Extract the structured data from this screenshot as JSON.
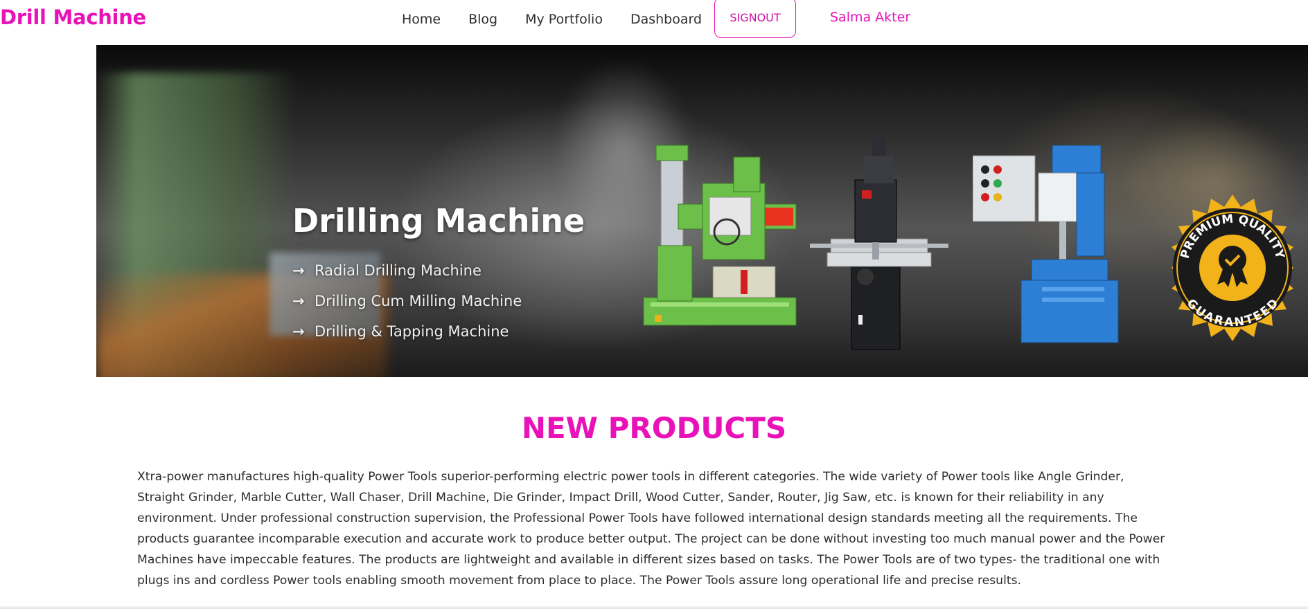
{
  "navbar": {
    "brand": "Drill Machine",
    "links": [
      "Home",
      "Blog",
      "My Portfolio",
      "Dashboard"
    ],
    "signout_label": "SIGNOUT",
    "user_name": "Salma Akter"
  },
  "banner": {
    "title": "Drilling Machine",
    "items": [
      "Radial Drilling Machine",
      "Drilling Cum Milling Machine",
      "Drilling & Tapping Machine"
    ],
    "arrow": "→",
    "badge_top": "PREMIUM QUALITY",
    "badge_bottom": "GUARANTEED"
  },
  "new_products": {
    "title": "NEW PRODUCTS",
    "description": "Xtra-power manufactures high-quality Power Tools superior-performing electric power tools in different categories. The wide variety of Power tools like Angle Grinder, Straight Grinder, Marble Cutter, Wall Chaser, Drill Machine, Die Grinder, Impact Drill, Wood Cutter, Sander, Router, Jig Saw, etc. is known for their reliability in any environment. Under professional construction supervision, the Professional Power Tools have followed international design standards meeting all the requirements. The products guarantee incomparable execution and accurate work to produce better output. The project can be done without investing too much manual power and the Power Machines have impeccable features. The products are lightweight and available in different sizes based on tasks. The Power Tools are of two types- the traditional one with plugs ins and cordless Power tools enabling smooth movement from place to place. The Power Tools assure long operational life and precise results."
  },
  "colors": {
    "accent": "#e812b8",
    "text": "#2d2d2d",
    "machine_green": "#6cc04a",
    "machine_blue": "#2d7fd6",
    "badge_gold": "#f2b21a"
  }
}
